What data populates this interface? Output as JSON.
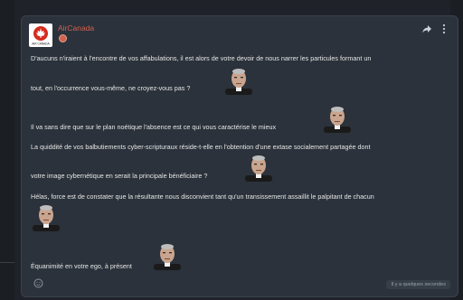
{
  "post": {
    "username": "AirCanada",
    "avatar_caption": "AIR CANADA",
    "lines": [
      "D'aucuns n'iraient à l'encontre de vos affabulations, il est alors de votre devoir de nous narrer les particules formant un",
      "tout, en l'occurrence vous-même, ne croyez-vous pas ?",
      "Il va sans dire que sur le plan noétique l'absence est ce qui vous caractérise le mieux",
      "La quiddité de vos balbutiements cyber-scripturaux réside-t-elle en l'obtention d'une extase socialement partagée dont",
      "votre image cybernétique en serait la principale bénéficiaire ?",
      "Hélas, force est de constater que la résultante nous disconvient tant qu'un transissement assaillit le palpitant de chacun",
      "Équanimité en votre ego, à présent"
    ],
    "timestamp": "Il y a quelques secondes"
  },
  "colors": {
    "brand": "#d0624f",
    "card": "#2b323b",
    "text": "#e6e6e6"
  }
}
